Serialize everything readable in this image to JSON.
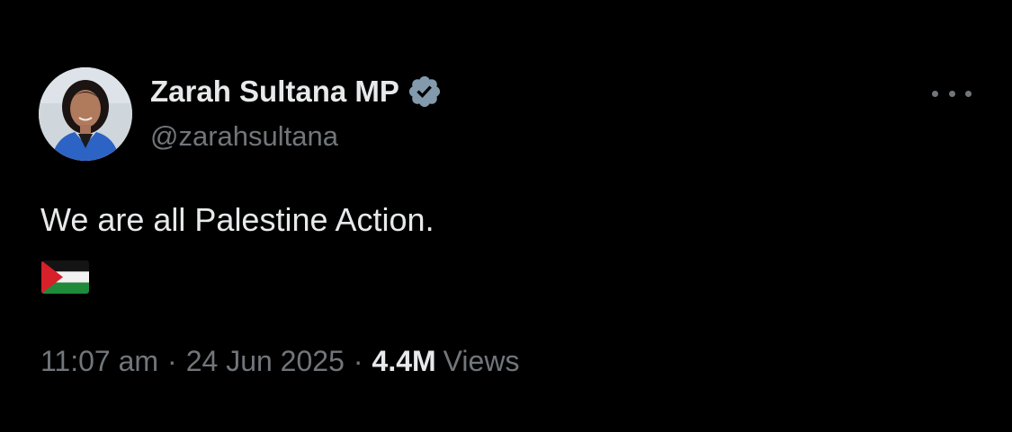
{
  "author": {
    "display_name": "Zarah Sultana MP",
    "handle": "@zarahsultana",
    "verified": true,
    "verified_icon": "verified-badge-icon"
  },
  "tweet": {
    "text": "We are all Palestine Action.",
    "emoji": "palestine-flag"
  },
  "meta": {
    "time": "11:07 am",
    "separator": "·",
    "date": "24 Jun 2025",
    "views_count": "4.4M",
    "views_label": "Views"
  },
  "colors": {
    "background": "#000000",
    "primary_text": "#e7e9ea",
    "secondary_text": "#71767b",
    "verified_badge": "#829aab"
  }
}
